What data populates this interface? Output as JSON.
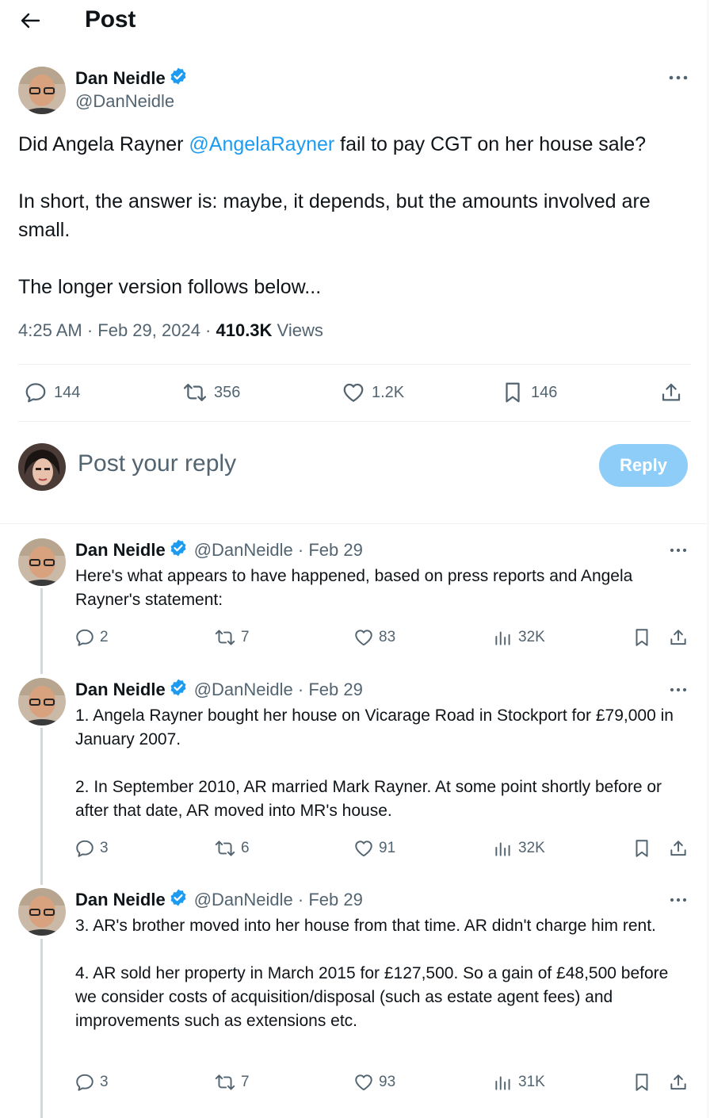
{
  "header": {
    "title": "Post"
  },
  "main_post": {
    "author_name": "Dan Neidle",
    "author_handle": "@DanNeidle",
    "text_before_mention": "Did Angela Rayner ",
    "mention": "@AngelaRayner",
    "text_after_mention": " fail to pay CGT on her house sale?",
    "paragraph2": "In short, the answer is: maybe, it depends, but the amounts involved are small.",
    "paragraph3": "The longer version follows below...",
    "time": "4:25 AM · Feb 29, 2024 · ",
    "views_count": "410.3K",
    "views_label": " Views",
    "stats": {
      "replies": "144",
      "reposts": "356",
      "likes": "1.2K",
      "bookmarks": "146"
    }
  },
  "reply_box": {
    "placeholder": "Post your reply",
    "button_label": "Reply"
  },
  "thread": [
    {
      "author_name": "Dan Neidle",
      "handle_date": "@DanNeidle · Feb 29",
      "paragraphs": [
        "Here's what appears to have happened, based on press reports and Angela Rayner's statement:"
      ],
      "replies": "2",
      "reposts": "7",
      "likes": "83",
      "views": "32K"
    },
    {
      "author_name": "Dan Neidle",
      "handle_date": "@DanNeidle · Feb 29",
      "paragraphs": [
        "1. Angela Rayner bought her house on Vicarage Road in Stockport for £79,000 in January 2007.",
        "2. In September 2010, AR married Mark Rayner. At some point shortly before or after that date, AR moved into MR's house."
      ],
      "replies": "3",
      "reposts": "6",
      "likes": "91",
      "views": "32K"
    },
    {
      "author_name": "Dan Neidle",
      "handle_date": "@DanNeidle · Feb 29",
      "paragraphs": [
        "3. AR's brother moved into her house from that time. AR didn't charge him rent.",
        "4. AR sold her property in March 2015 for £127,500. So a gain of £48,500 before we consider costs of acquisition/disposal (such as estate agent fees) and improvements such as extensions etc."
      ],
      "replies": "3",
      "reposts": "7",
      "likes": "93",
      "views": "31K"
    }
  ],
  "colors": {
    "accent": "#1d9bf0",
    "reply_button": "#8ecdf8",
    "muted": "#536471",
    "text": "#0f1419",
    "divider": "#eff3f4"
  },
  "icons": [
    "back-arrow-icon",
    "verified-badge-icon",
    "more-icon",
    "reply-icon",
    "repost-icon",
    "like-icon",
    "bookmark-icon",
    "share-icon",
    "views-icon"
  ]
}
